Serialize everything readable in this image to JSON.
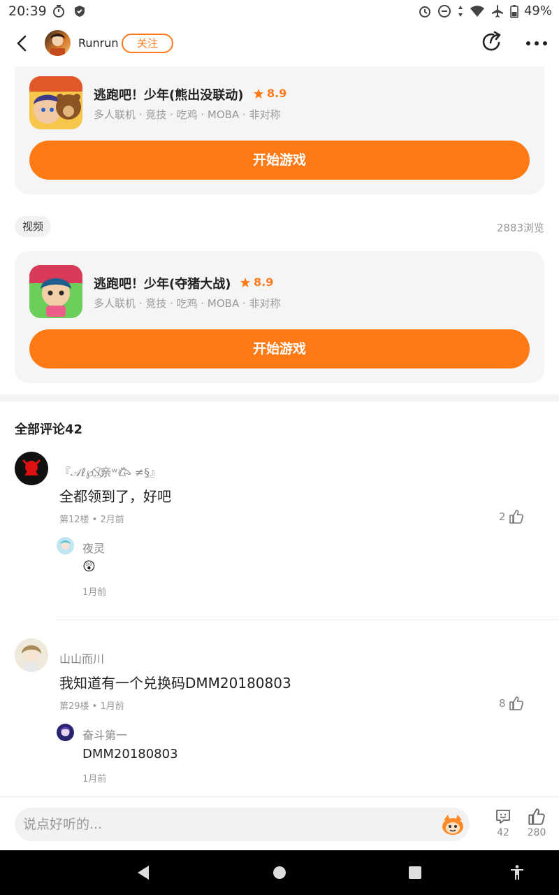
{
  "status_bar": {
    "time": "20:39",
    "battery": "49%"
  },
  "header": {
    "author_name": "Runrun",
    "follow_label": "关注"
  },
  "games": [
    {
      "title": "逃跑吧！少年(熊出没联动)",
      "rating": "8.9",
      "tags": "多人联机 · 竞技 · 吃鸡 · MOBA · 非对称",
      "play_label": "开始游戏",
      "icon": "game-icon-bear-collab"
    },
    {
      "title": "逃跑吧！少年(夺猪大战)",
      "rating": "8.9",
      "tags": "多人联机 · 竞技 · 吃鸡 · MOBA · 非对称",
      "play_label": "开始游戏",
      "icon": "game-icon-pig-battle"
    }
  ],
  "post_meta": {
    "tag": "视频",
    "views": "2883浏览"
  },
  "comments_section": {
    "title": "全部评论42",
    "comments": [
      {
        "name": "『𝒜ℓ℘./⃠亲ʷ𐂃 ≠§』",
        "text": "全都领到了，好吧",
        "meta": "第12楼 • 2月前",
        "likes": "2",
        "reply": {
          "name": "夜灵",
          "text": "😲",
          "meta": "1月前"
        }
      },
      {
        "name": "山山而川",
        "text": "我知道有一个兑换码DMM20180803",
        "meta": "第29楼 • 1月前",
        "likes": "8",
        "reply": {
          "name": "奋斗第一",
          "text": "DMM20180803",
          "meta": "1月前"
        }
      }
    ]
  },
  "bottom_bar": {
    "input_placeholder": "说点好听的...",
    "comment_count": "42",
    "like_count": "280"
  },
  "colors": {
    "accent": "#ff7a14",
    "card_bg": "#f5f5f5",
    "muted_text": "#999999"
  }
}
